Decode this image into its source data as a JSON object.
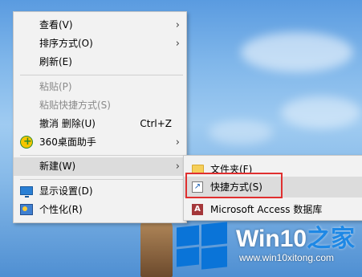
{
  "context_menu": {
    "items": [
      {
        "label": "查看(V)",
        "has_submenu": true,
        "enabled": true
      },
      {
        "label": "排序方式(O)",
        "has_submenu": true,
        "enabled": true
      },
      {
        "label": "刷新(E)",
        "has_submenu": false,
        "enabled": true
      },
      {
        "label": "粘贴(P)",
        "has_submenu": false,
        "enabled": false
      },
      {
        "label": "粘贴快捷方式(S)",
        "has_submenu": false,
        "enabled": false
      },
      {
        "label": "撤消 删除(U)",
        "shortcut": "Ctrl+Z",
        "has_submenu": false,
        "enabled": true
      },
      {
        "label": "360桌面助手",
        "icon": "360-icon",
        "has_submenu": true,
        "enabled": true
      },
      {
        "label": "新建(W)",
        "has_submenu": true,
        "enabled": true,
        "highlighted": true
      },
      {
        "label": "显示设置(D)",
        "icon": "display-settings-icon",
        "has_submenu": false,
        "enabled": true
      },
      {
        "label": "个性化(R)",
        "icon": "personalize-icon",
        "has_submenu": false,
        "enabled": true
      }
    ]
  },
  "new_submenu": {
    "items": [
      {
        "label": "文件夹(F)",
        "icon": "folder-icon"
      },
      {
        "label": "快捷方式(S)",
        "icon": "shortcut-icon",
        "highlighted": true
      },
      {
        "label": "Microsoft Access 数据库",
        "icon": "access-icon"
      }
    ]
  },
  "watermark": {
    "title_main": "Win10",
    "title_accent": "之家",
    "url": "www.win10xitong.com"
  },
  "colors": {
    "highlight_border": "#e03030",
    "windows_blue": "#0a74d8",
    "menu_bg": "#f2f2f2"
  }
}
